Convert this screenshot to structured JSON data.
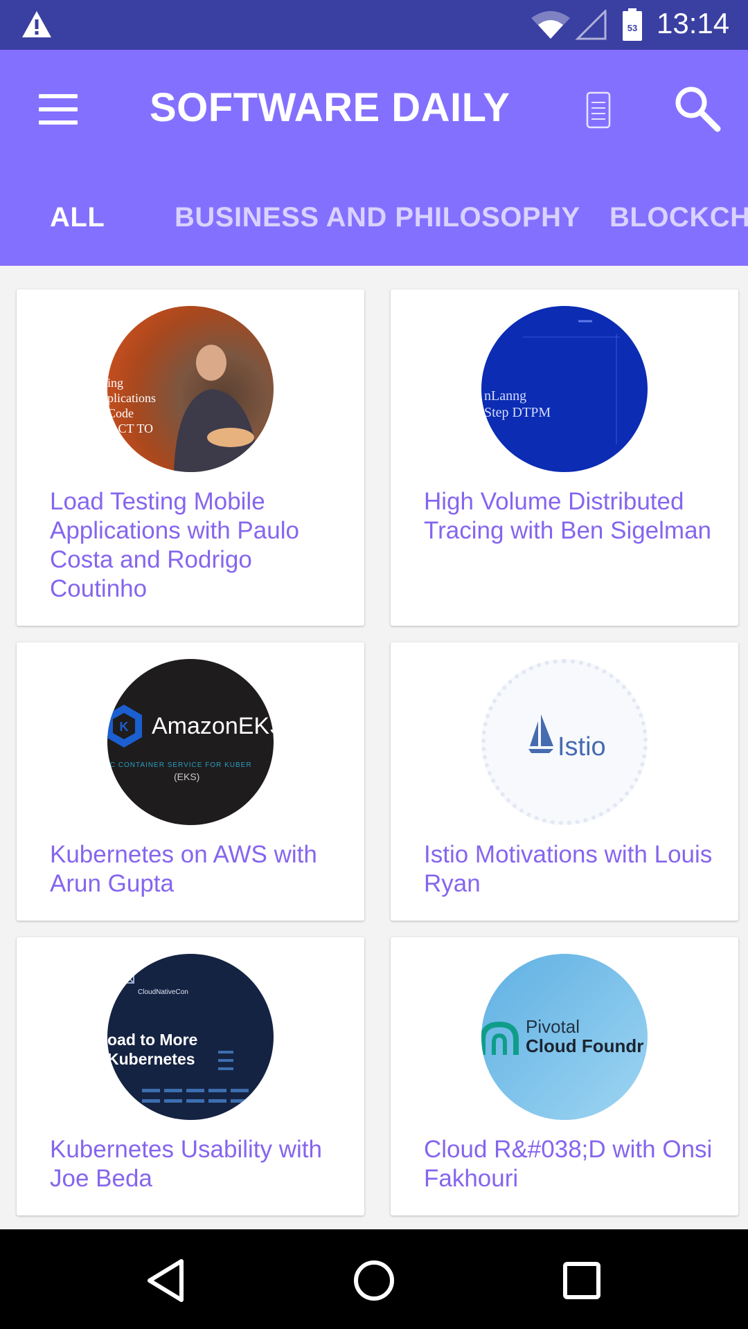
{
  "status_bar": {
    "time": "13:14",
    "battery_level": "53",
    "icons": [
      "warning-icon",
      "wifi-icon",
      "cell-signal-icon",
      "battery-icon"
    ]
  },
  "app_bar": {
    "title": "SOFTWARE DAILY",
    "icons": [
      "menu-icon",
      "notes-icon",
      "search-icon"
    ],
    "background_color": "#8470ff"
  },
  "tabs": [
    {
      "label": "ALL",
      "active": true
    },
    {
      "label": "BUSINESS AND PHILOSOPHY",
      "active": false
    },
    {
      "label": "BLOCKCHA",
      "active": false
    }
  ],
  "episodes": [
    {
      "title": "Load Testing Mobile Applications with Paulo Costa and Rodrigo Coutinho",
      "thumb_text": "ing\nplications\nCode\nE CT TO"
    },
    {
      "title": "High Volume Distributed Tracing with Ben Sigelman",
      "thumb_text": "nLanng\nStep DTPM"
    },
    {
      "title": "Kubernetes on AWS with Arun Gupta",
      "thumb_brand": "AmazonEKS",
      "thumb_sub": "IC CONTAINER SERVICE FOR KUBER",
      "thumb_sub2": "(EKS)"
    },
    {
      "title": "Istio Motivations with Louis Ryan",
      "thumb_brand": "Istio"
    },
    {
      "title": "Kubernetes Usability with Joe Beda",
      "thumb_small": "CloudNativeCon",
      "thumb_text": "oad to More\nKubernetes"
    },
    {
      "title": "Cloud R&#038;D with Onsi Fakhouri",
      "thumb_brand1": "Pivotal",
      "thumb_brand2": "Cloud Foundr"
    }
  ],
  "nav_bar": {
    "icons": [
      "back-icon",
      "home-icon",
      "recents-icon"
    ]
  },
  "colors": {
    "status_bar": "#3a3fa2",
    "accent": "#8470ff",
    "card_title": "#8565ee"
  }
}
